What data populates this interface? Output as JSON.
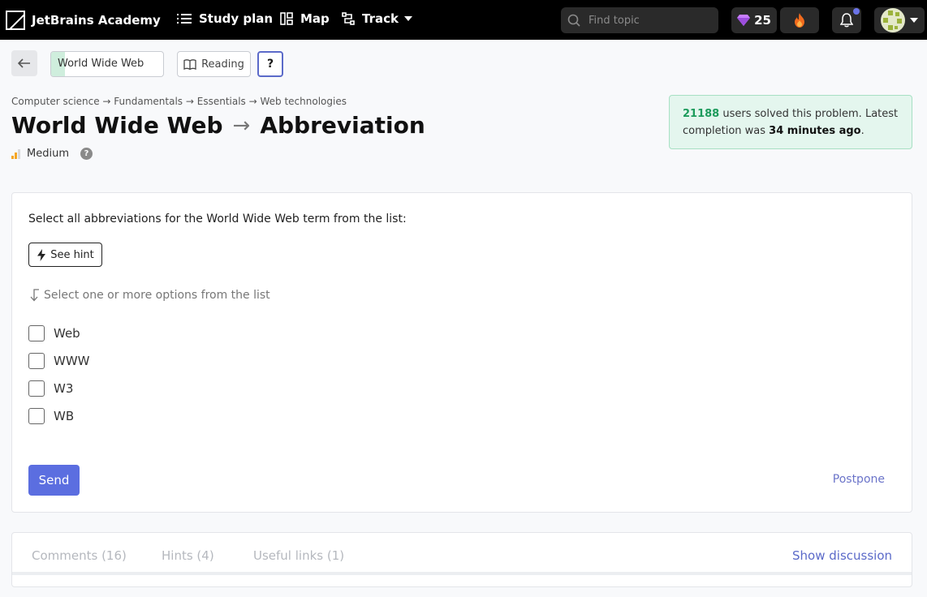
{
  "nav": {
    "logo_text": "JetBrains Academy",
    "study_plan": "Study plan",
    "map": "Map",
    "track": "Track",
    "search_placeholder": "Find topic",
    "gems": "25"
  },
  "toolbar": {
    "topic_label": "World Wide Web",
    "topic_progress": 0.12,
    "reading_label": "Reading",
    "help_label": "?"
  },
  "breadcrumb": "Computer science → Fundamentals → Essentials → Web technologies",
  "title": {
    "topic": "World Wide Web",
    "arrow": "→",
    "step": "Abbreviation"
  },
  "difficulty": "Medium",
  "solved": {
    "count": "21188",
    "text_1": " users solved this problem. Latest completion was ",
    "recent": "34 minutes ago",
    "text_2": "."
  },
  "question": {
    "text": "Select all abbreviations for the World Wide Web term from the list:",
    "hint_button": "See hint",
    "instruction": "Select one or more options from the list",
    "options": [
      "Web",
      "WWW",
      "W3",
      "WB"
    ],
    "send": "Send",
    "postpone": "Postpone"
  },
  "discussion": {
    "tabs": [
      "Comments (16)",
      "Hints (4)",
      "Useful links (1)"
    ],
    "show": "Show discussion"
  },
  "colors": {
    "accent": "#5b6ee0",
    "success_bg": "#e4f6ee",
    "success_text": "#1d9b5c"
  }
}
